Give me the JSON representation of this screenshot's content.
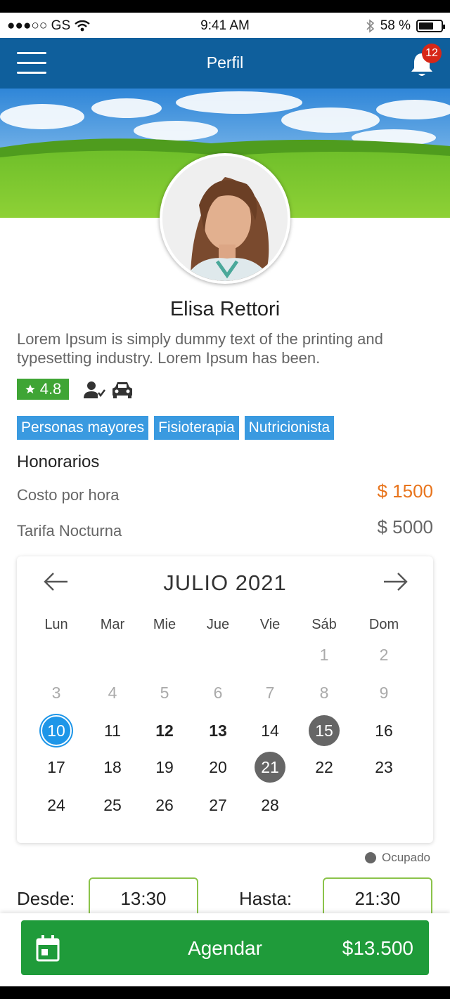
{
  "status_bar": {
    "carrier": "●●●○○ GS",
    "time": "9:41 AM",
    "battery_text": "58 %"
  },
  "nav": {
    "title": "Perfil",
    "notification_count": "12"
  },
  "profile": {
    "name": "Elisa Rettori",
    "bio": "Lorem Ipsum is simply dummy text of the printing and typesetting industry. Lorem Ipsum has been.",
    "rating": "4.8",
    "tags": [
      "Personas mayores",
      "Fisioterapia",
      "Nutricionista"
    ]
  },
  "honorarios": {
    "title": "Honorarios",
    "rows": [
      {
        "label": "Costo por hora",
        "amount": "$ 1500",
        "color": "#e8741c"
      },
      {
        "label": "Tarifa Nocturna",
        "amount": "$ 5000",
        "color": "#666666"
      }
    ]
  },
  "calendar": {
    "month": "JULIO 2021",
    "weekdays": [
      "Lun",
      "Mar",
      "Mie",
      "Jue",
      "Vie",
      "Sáb",
      "Dom"
    ],
    "rows": [
      [
        {
          "d": ""
        },
        {
          "d": ""
        },
        {
          "d": ""
        },
        {
          "d": ""
        },
        {
          "d": ""
        },
        {
          "d": "1",
          "s": "past"
        },
        {
          "d": "2",
          "s": "past"
        }
      ],
      [
        {
          "d": "3",
          "s": "past"
        },
        {
          "d": "4",
          "s": "past"
        },
        {
          "d": "5",
          "s": "past"
        },
        {
          "d": "6",
          "s": "past"
        },
        {
          "d": "7",
          "s": "past"
        },
        {
          "d": "8",
          "s": "past"
        },
        {
          "d": "9",
          "s": "past"
        }
      ],
      [
        {
          "d": "10",
          "s": "selected"
        },
        {
          "d": "11"
        },
        {
          "d": "12",
          "s": "bold"
        },
        {
          "d": "13",
          "s": "bold"
        },
        {
          "d": "14"
        },
        {
          "d": "15",
          "s": "busy"
        },
        {
          "d": "16"
        }
      ],
      [
        {
          "d": "17"
        },
        {
          "d": "18"
        },
        {
          "d": "19"
        },
        {
          "d": "20"
        },
        {
          "d": "21",
          "s": "busy"
        },
        {
          "d": "22"
        },
        {
          "d": "23"
        }
      ],
      [
        {
          "d": "24"
        },
        {
          "d": "25"
        },
        {
          "d": "26"
        },
        {
          "d": "27"
        },
        {
          "d": "28"
        },
        {
          "d": ""
        },
        {
          "d": ""
        }
      ]
    ],
    "legend": "Ocupado",
    "selected_color": "#1e96e8",
    "busy_color": "#666666"
  },
  "time_range": {
    "from_label": "Desde:",
    "from_value": "13:30",
    "to_label": "Hasta:",
    "to_value": "21:30"
  },
  "cta": {
    "label": "Agendar",
    "price": "$13.500"
  },
  "colors": {
    "navbar": "#0f5f9c",
    "tag": "#3a9ae0",
    "rating": "#3fa535",
    "cta": "#1f9b3a",
    "accent_orange": "#e8741c"
  }
}
